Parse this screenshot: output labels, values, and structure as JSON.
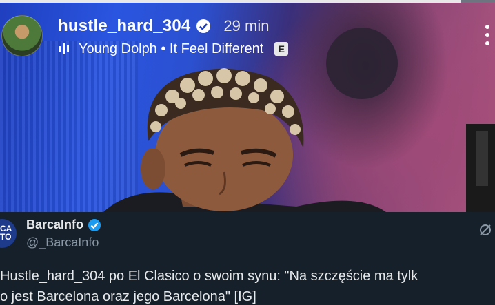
{
  "story": {
    "progress": 0.93,
    "username": "hustle_hard_304",
    "time_ago": "29 min",
    "music": "Young Dolph • It Feel Different",
    "explicit_badge": "E"
  },
  "tweet": {
    "account_name": "BarcaInfo",
    "handle": "@_BarcaInfo",
    "avatar_text": "CA\nTO",
    "text_line1": "Hustle_hard_304 po El Clasico o swoim synu: \"Na szczęście ma tylk",
    "text_line2": "o jest Barcelona oraz jego Barcelona\" [IG]"
  },
  "colors": {
    "verified_blue": "#1d9bf0",
    "tweet_bg": "#15202b"
  }
}
